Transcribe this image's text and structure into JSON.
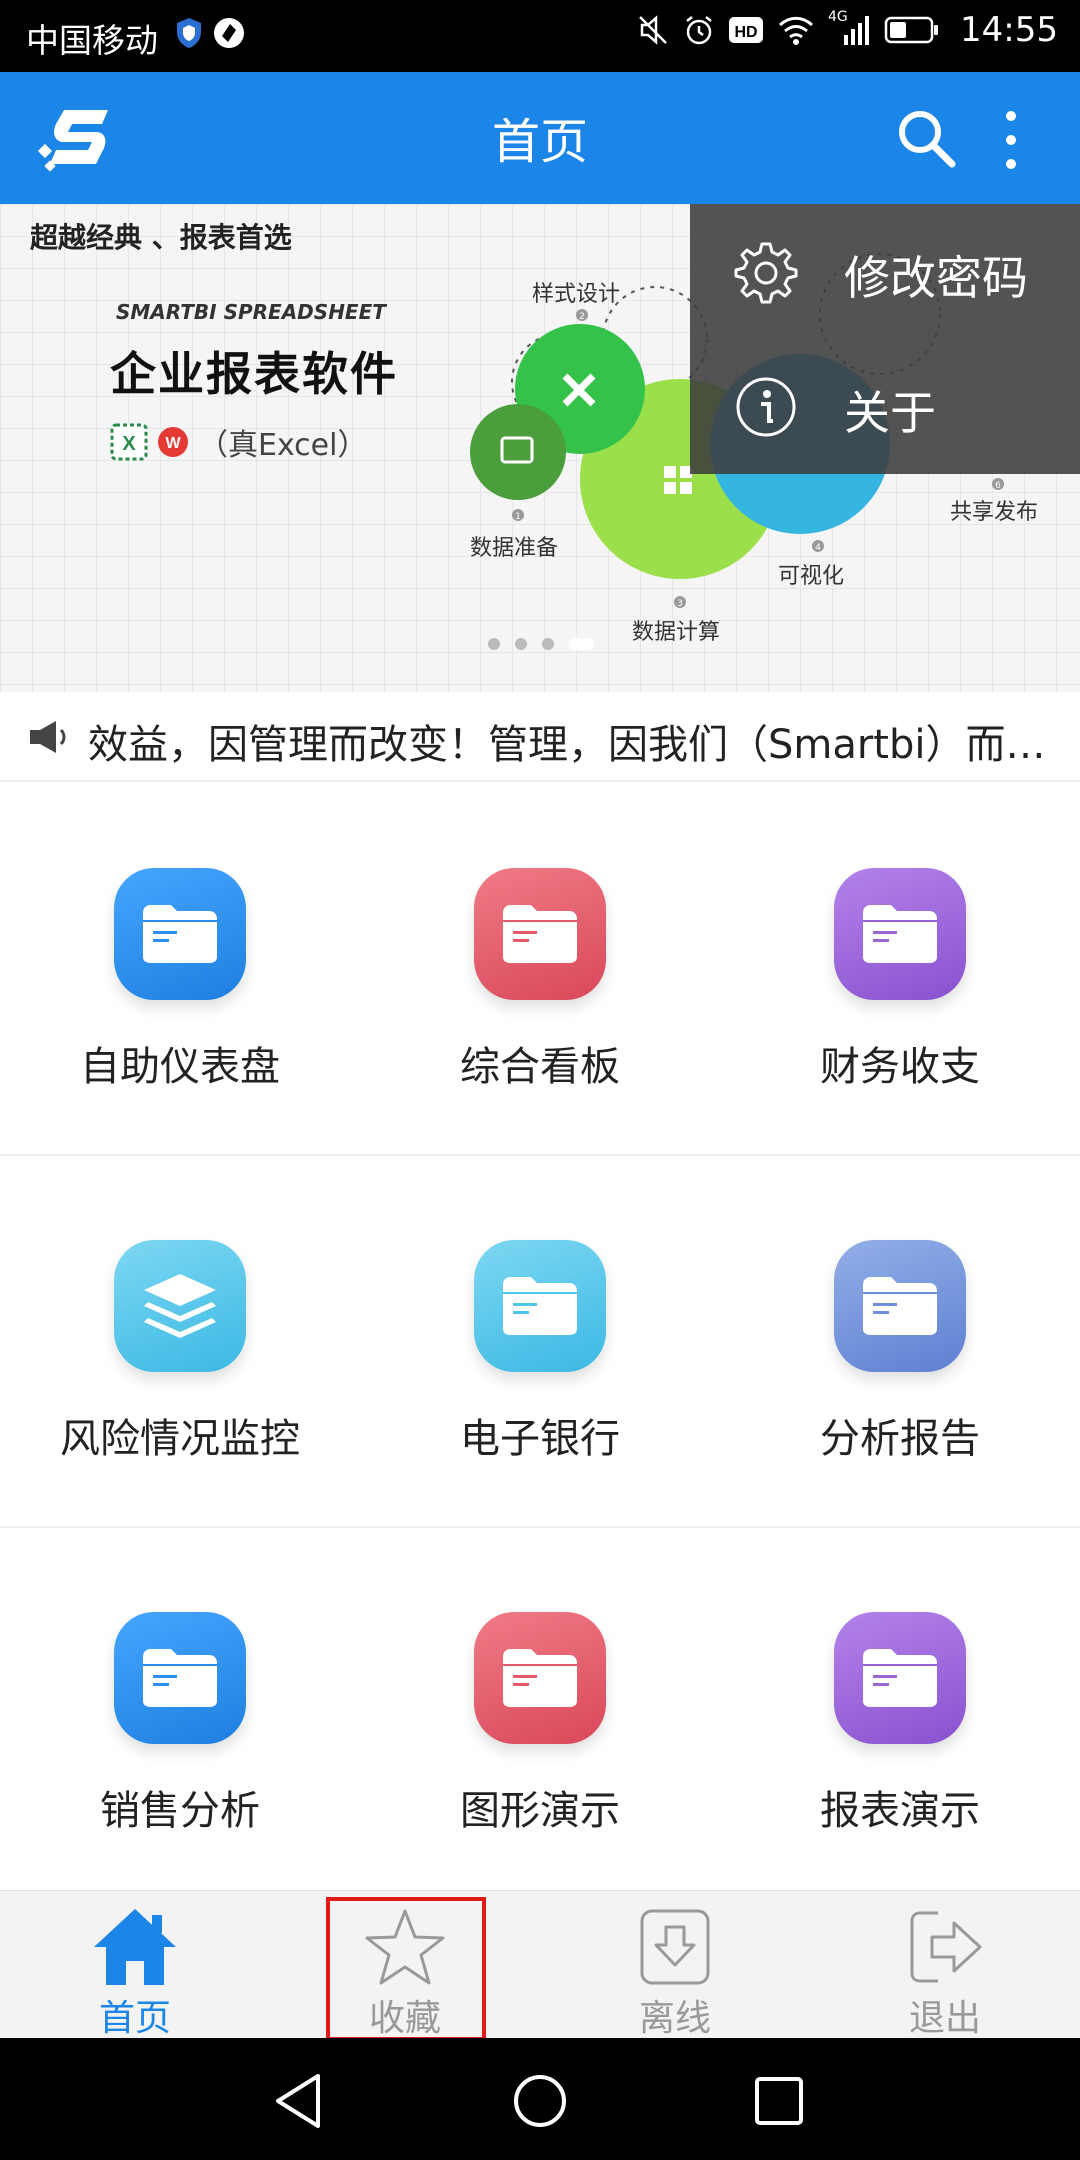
{
  "status_bar": {
    "carrier": "中国移动",
    "network": "4G",
    "time": "14:55"
  },
  "app_bar": {
    "title": "首页",
    "logo_icon": "smartbi-logo-icon",
    "search_icon": "search-icon",
    "more_icon": "more-vert-icon",
    "color": "#1b85e8"
  },
  "banner": {
    "slogan": "超越经典 、报表首选",
    "brand": "SMARTBI SPREADSHEET",
    "product": "企业报表软件",
    "excel": "（真Excel）",
    "labels": {
      "style_design": "样式设计",
      "data_prep": "数据准备",
      "data_calc": "数据计算",
      "visualize": "可视化",
      "share_publish": "共享发布"
    },
    "step_numbers": [
      "1",
      "2",
      "3",
      "4",
      "6"
    ],
    "active_dot": 4,
    "dot_count": 4
  },
  "overflow_menu": {
    "items": [
      {
        "label": "修改密码",
        "icon": "gear-icon"
      },
      {
        "label": "关于",
        "icon": "info-icon"
      }
    ]
  },
  "marquee": {
    "icon": "megaphone-icon",
    "text": "效益，因管理而改变！管理，因我们（Smartbi）而…"
  },
  "grid": [
    [
      {
        "label": "自助仪表盘",
        "icon": "folder-icon",
        "color": "#2b8ff0"
      },
      {
        "label": "综合看板",
        "icon": "folder-icon",
        "color": "#e55a68"
      },
      {
        "label": "财务收支",
        "icon": "folder-icon",
        "color": "#9b63d6"
      }
    ],
    [
      {
        "label": "风险情况监控",
        "icon": "layers-icon",
        "color": "#4ec6ea"
      },
      {
        "label": "电子银行",
        "icon": "folder-icon",
        "color": "#4ec6ea"
      },
      {
        "label": "分析报告",
        "icon": "folder-icon",
        "color": "#6d8fdc"
      }
    ],
    [
      {
        "label": "销售分析",
        "icon": "folder-icon",
        "color": "#2b8ff0"
      },
      {
        "label": "图形演示",
        "icon": "folder-icon",
        "color": "#e55a68"
      },
      {
        "label": "报表演示",
        "icon": "folder-icon",
        "color": "#9b63d6"
      }
    ]
  ],
  "tabs": [
    {
      "label": "首页",
      "icon": "home-icon",
      "active": true
    },
    {
      "label": "收藏",
      "icon": "star-icon",
      "active": false
    },
    {
      "label": "离线",
      "icon": "download-icon",
      "active": false
    },
    {
      "label": "退出",
      "icon": "exit-icon",
      "active": false
    }
  ],
  "system_nav": {
    "back_icon": "back-triangle-icon",
    "home_icon": "home-circle-icon",
    "recents_icon": "recents-square-icon"
  }
}
